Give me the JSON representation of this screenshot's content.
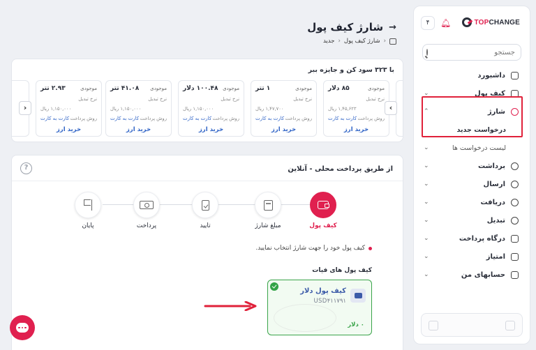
{
  "brand": {
    "logo_prefix": "TOP",
    "logo_suffix": "CHANGE",
    "notif_count": "۴"
  },
  "search": {
    "placeholder": "جستجو"
  },
  "sidebar": {
    "items": [
      {
        "label": "داشبورد"
      },
      {
        "label": "کیف پول"
      },
      {
        "label": "شارژ"
      },
      {
        "label": "درخواست جدید"
      },
      {
        "label": "لیست درخواست ها"
      },
      {
        "label": "برداشت"
      },
      {
        "label": "ارسال"
      },
      {
        "label": "دریافت"
      },
      {
        "label": "تبدیل"
      },
      {
        "label": "درگاه پرداخت"
      },
      {
        "label": "امتیاز"
      },
      {
        "label": "حسابهای من"
      }
    ]
  },
  "header": {
    "title": "شارژ کیف پول"
  },
  "breadcrumb": {
    "item1": "شارژ کیف پول",
    "item2": "جدید"
  },
  "earn": {
    "title": "با ۳۲۳ سود کن و جایزه ببر"
  },
  "asset_labels": {
    "balance": "موجودی",
    "rate": "نرخ تبدیل",
    "method": "روش پرداخت",
    "method_value": "کارت به کارت",
    "buy": "خرید ارز"
  },
  "assets": [
    {
      "balance": "۸۵ دلار",
      "rate": "۱,۴۵,۶۲۳ ریال"
    },
    {
      "balance": "۱ تتر",
      "rate": "۱,۴۷,۷۰۰ ریال"
    },
    {
      "balance": "۱۰۰.۴۸ دلار",
      "rate": "۱,۱۵۰,۰۰۰ ریال"
    },
    {
      "balance": "۴۱.۰۸ تتر",
      "rate": "۱,۱۵۰,۰۰۰ ریال"
    },
    {
      "balance": "۲.۹۳ تتر",
      "rate": "۱,۱۵۰,۰۰۰ ریال"
    }
  ],
  "main": {
    "title": "از طریق پرداخت محلی - آنلاین",
    "help": "?",
    "steps": [
      {
        "label": "کیف پول"
      },
      {
        "label": "مبلغ شارژ"
      },
      {
        "label": "تایید"
      },
      {
        "label": "پرداخت"
      },
      {
        "label": "پایان"
      }
    ],
    "note": "کیف پول خود را جهت شارژ انتخاب نمایید.",
    "section_label": "کیف پول های فیات",
    "wallet": {
      "name": "کیف پول دلار",
      "id": "USD۴۱۱۷۹۱",
      "balance": "۰ دلار"
    }
  },
  "colors": {
    "accent": "#e0204f",
    "link": "#2f63c6",
    "success": "#3aa44a",
    "annotation": "#e0213a"
  }
}
